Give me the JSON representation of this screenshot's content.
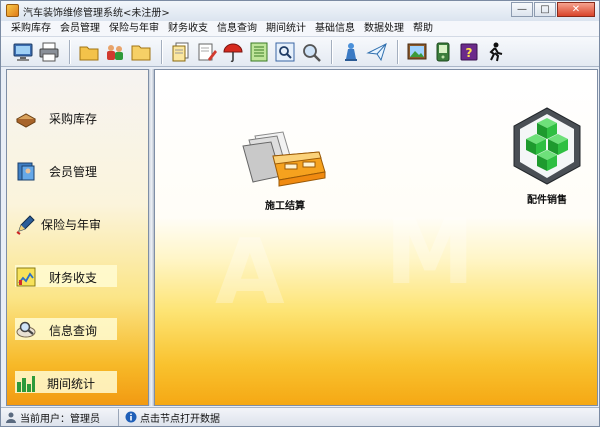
{
  "window": {
    "title": "汽车装饰维修管理系统<未注册>",
    "controls": {
      "minimize": "—",
      "maximize": "□",
      "close": "✕"
    }
  },
  "menu": [
    {
      "label": "采购库存"
    },
    {
      "label": "会员管理"
    },
    {
      "label": "保险与年审"
    },
    {
      "label": "财务收支"
    },
    {
      "label": "信息查询"
    },
    {
      "label": "期间统计"
    },
    {
      "label": "基础信息"
    },
    {
      "label": "数据处理"
    },
    {
      "label": "帮助"
    }
  ],
  "toolbar": {
    "icons": [
      "monitor-icon",
      "printer-icon",
      "folder-icon",
      "people-icon",
      "folder-open-icon",
      "document-stack-icon",
      "document-edit-icon",
      "umbrella-icon",
      "notebook-icon",
      "magnifier-doc-icon",
      "magnifier-icon",
      "chess-piece-icon",
      "paper-plane-icon",
      "picture-frame-icon",
      "handheld-device-icon",
      "help-book-icon",
      "runner-icon"
    ]
  },
  "nav": [
    {
      "label": "采购库存",
      "icon": "book-icon"
    },
    {
      "label": "会员管理",
      "icon": "member-card-icon"
    },
    {
      "label": "保险与年审",
      "icon": "pen-check-icon"
    },
    {
      "label": "财务收支",
      "icon": "finance-chart-icon"
    },
    {
      "label": "信息查询",
      "icon": "search-magnifier-icon"
    },
    {
      "label": "期间统计",
      "icon": "bar-stats-icon"
    }
  ],
  "modules": [
    {
      "label": "施工结算",
      "icon": "drawer-folders-icon"
    },
    {
      "label": "配件销售",
      "icon": "green-cubes-icon"
    }
  ],
  "status": {
    "user": "当前用户：管理员",
    "hint": "点击节点打开数据"
  },
  "colors": {
    "accent": "#f5a814",
    "panel_yellow": "#fde474",
    "frame": "#7f8ea5"
  }
}
